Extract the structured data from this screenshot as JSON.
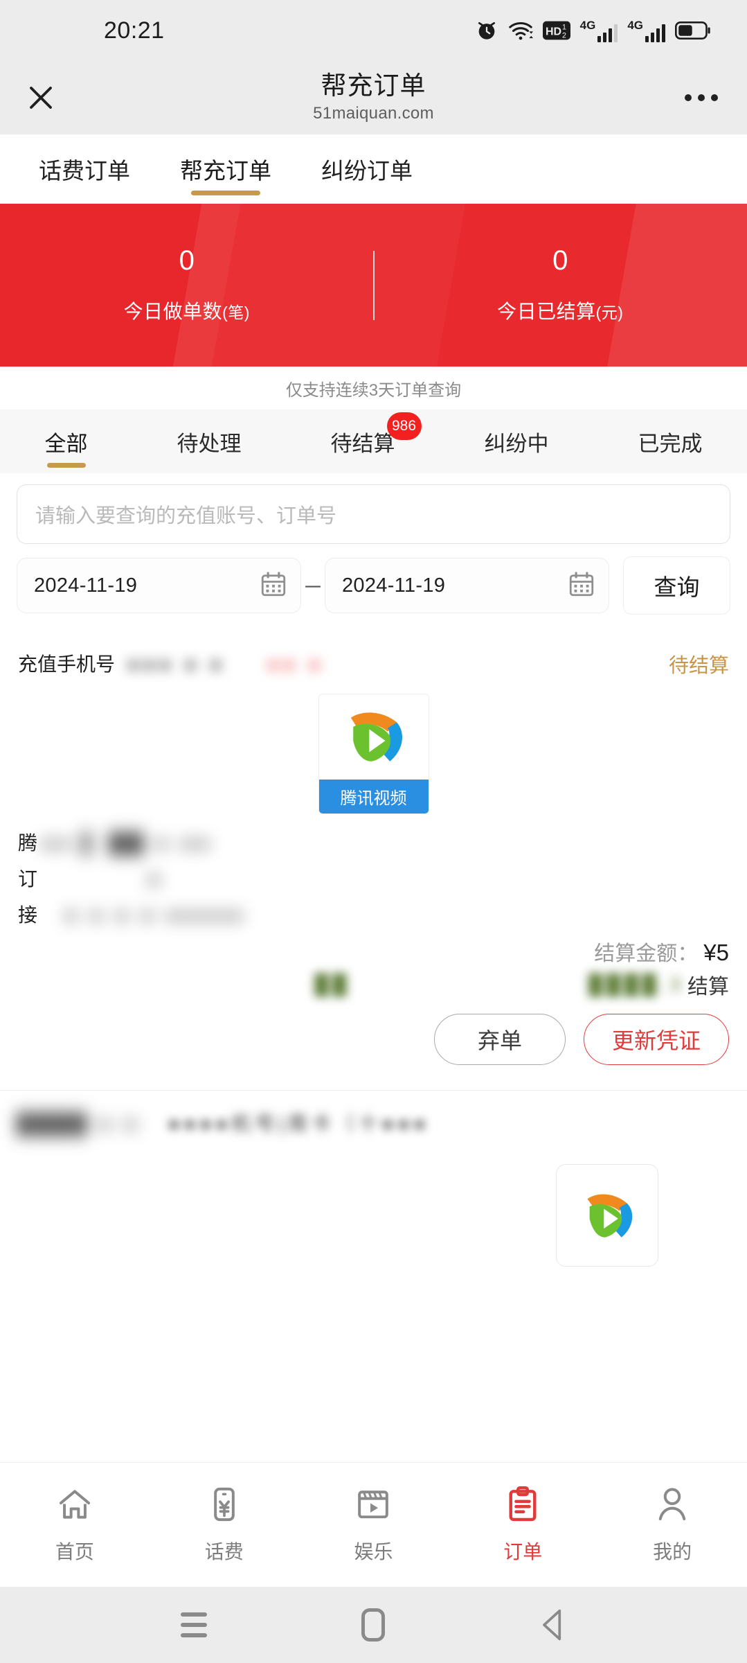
{
  "status_bar": {
    "time": "20:21",
    "icons": [
      "alarm-icon",
      "wifi-icon",
      "hd-voice-icon",
      "signal-4g-icon",
      "signal-4g-icon",
      "battery-icon"
    ],
    "network_label": "4G",
    "hd_label": "HD"
  },
  "header": {
    "title": "帮充订单",
    "subtitle": "51maiquan.com",
    "close_icon": "close-icon",
    "more_icon": "more-icon"
  },
  "top_tabs": [
    {
      "label": "话费订单",
      "active": false
    },
    {
      "label": "帮充订单",
      "active": true
    },
    {
      "label": "纠纷订单",
      "active": false
    }
  ],
  "banner": {
    "bg_color": "#e8272c",
    "stats": [
      {
        "value": "0",
        "label": "今日做单数",
        "unit": "(笔)"
      },
      {
        "value": "0",
        "label": "今日已结算",
        "unit": "(元)"
      }
    ]
  },
  "hint": "仅支持连续3天订单查询",
  "filter_tabs": [
    {
      "label": "全部",
      "active": true,
      "badge": ""
    },
    {
      "label": "待处理",
      "active": false,
      "badge": ""
    },
    {
      "label": "待结算",
      "active": false,
      "badge": "986"
    },
    {
      "label": "纠纷中",
      "active": false,
      "badge": ""
    },
    {
      "label": "已完成",
      "active": false,
      "badge": ""
    }
  ],
  "search": {
    "placeholder": "请输入要查询的充值账号、订单号",
    "value": "",
    "date_from": "2024-11-19",
    "date_to": "2024-11-19",
    "separator": "－",
    "calendar_icon": "calendar-icon",
    "query_button": "查询"
  },
  "orders": [
    {
      "field_label": "充值手机号",
      "field_value_masked": "●●●  ●  ●",
      "extra_masked": "●●  ●",
      "status": "待结算",
      "status_color": "#c8944a",
      "product_logo": "tencent-video-logo",
      "product_caption": "腾讯视频",
      "detail_rows": [
        {
          "label": "腾",
          "value_masked": "●● ▌ ██ ● ●●"
        },
        {
          "label": "订",
          "value_masked": "●"
        },
        {
          "label": "接",
          "value_masked": "● ● ● ● ●●●●●"
        }
      ],
      "amount_label": "结算金额：",
      "amount_value": "¥5",
      "settle_masked": "████.3",
      "settle_label": "结算",
      "buttons": [
        {
          "label": "弃单",
          "style": "ghost"
        },
        {
          "label": "更新凭证",
          "style": "danger"
        }
      ]
    },
    {
      "field_label_masked": "████ ● ●",
      "field_value_masked": "●●●●机号|周卡（十●●●",
      "product_logo": "tencent-video-logo"
    }
  ],
  "bottom_nav": [
    {
      "label": "首页",
      "icon": "home-icon",
      "active": false
    },
    {
      "label": "话费",
      "icon": "phone-yen-icon",
      "active": false
    },
    {
      "label": "娱乐",
      "icon": "media-play-icon",
      "active": false
    },
    {
      "label": "订单",
      "icon": "clipboard-icon",
      "active": true
    },
    {
      "label": "我的",
      "icon": "person-icon",
      "active": false
    }
  ],
  "android_nav": {
    "recents_icon": "recents-icon",
    "home_icon": "home-square-icon",
    "back_icon": "back-triangle-icon"
  },
  "colors": {
    "brand_red": "#e8272c",
    "accent_gold": "#c79a4b",
    "status_gold": "#c8944a",
    "danger": "#e03a3a",
    "badge_red": "#f32020"
  }
}
